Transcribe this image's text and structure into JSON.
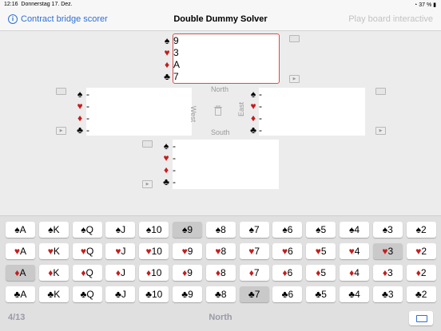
{
  "status": {
    "time": "12:16",
    "date": "Donnerstag 17. Dez.",
    "battery": "37 %"
  },
  "nav": {
    "left_label": "Contract bridge scorer",
    "title": "Double Dummy Solver",
    "right_label": "Play board interactive"
  },
  "hands": {
    "north": {
      "spades": "9",
      "hearts": "3",
      "diamonds": "A",
      "clubs": "7"
    },
    "west": {
      "spades": "-",
      "hearts": "-",
      "diamonds": "-",
      "clubs": "-"
    },
    "east": {
      "spades": "-",
      "hearts": "-",
      "diamonds": "-",
      "clubs": "-"
    },
    "south": {
      "spades": "-",
      "hearts": "-",
      "diamonds": "-",
      "clubs": "-"
    }
  },
  "compass": {
    "north": "North",
    "south": "South",
    "west": "West",
    "east": "East"
  },
  "suits": {
    "spade": "♠",
    "heart": "♥",
    "diamond": "♦",
    "club": "♣"
  },
  "colors": {
    "accent": "#2f6fd6",
    "red_suit": "#c61c1c",
    "selected_border": "#d94b4b"
  },
  "ranks": [
    "A",
    "K",
    "Q",
    "J",
    "10",
    "9",
    "8",
    "7",
    "6",
    "5",
    "4",
    "3",
    "2"
  ],
  "deck_rows": [
    {
      "suit": "spade",
      "used": [
        5
      ]
    },
    {
      "suit": "heart",
      "used": [
        11
      ]
    },
    {
      "suit": "diamond",
      "used": [
        0
      ]
    },
    {
      "suit": "club",
      "used": [
        7
      ]
    }
  ],
  "bottom": {
    "count": "4/13",
    "direction": "North"
  }
}
